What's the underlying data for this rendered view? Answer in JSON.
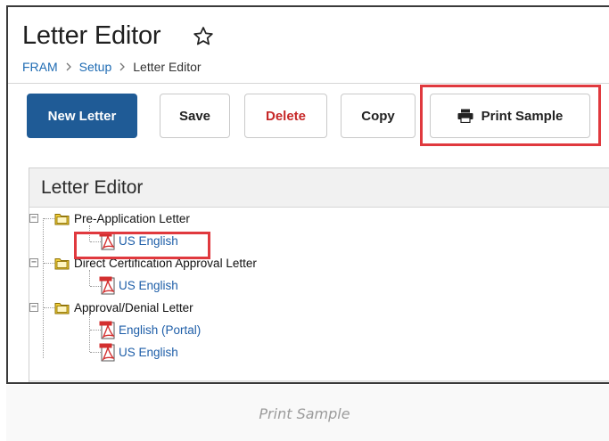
{
  "page": {
    "title": "Letter Editor",
    "breadcrumb": [
      "FRAM",
      "Setup",
      "Letter Editor"
    ]
  },
  "toolbar": {
    "new_label": "New Letter",
    "save_label": "Save",
    "delete_label": "Delete",
    "copy_label": "Copy",
    "print_label": "Print Sample"
  },
  "panel": {
    "title": "Letter Editor",
    "tree": [
      {
        "label": "Pre-Application Letter",
        "children": [
          "US English"
        ]
      },
      {
        "label": "Direct Certification Approval Letter",
        "children": [
          "US English"
        ]
      },
      {
        "label": "Approval/Denial Letter",
        "children": [
          "English (Portal)",
          "US English"
        ]
      }
    ]
  },
  "caption": "Print Sample",
  "colors": {
    "primary": "#1f5b96",
    "delete": "#c62828",
    "highlight": "#e0393e",
    "link": "#1e5ea8",
    "folder": "#f2cf3a",
    "pdf": "#d32f2f"
  },
  "icons": {
    "favorite": "star-icon",
    "print": "printer-icon",
    "folder": "folder-icon",
    "document": "pdf-icon"
  }
}
